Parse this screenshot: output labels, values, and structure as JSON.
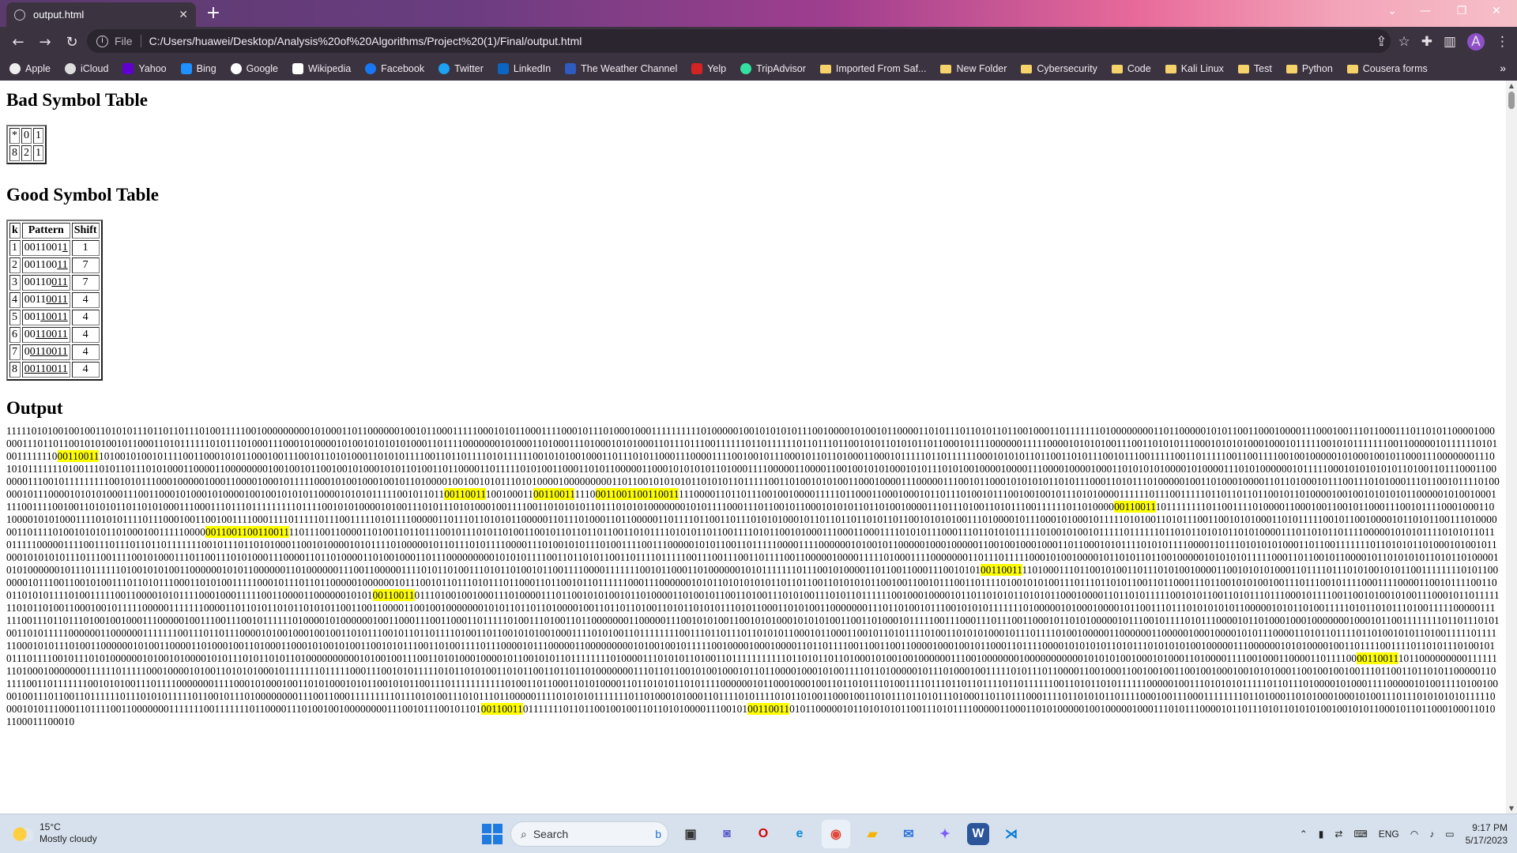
{
  "browser": {
    "tab_title": "output.html",
    "address_scheme": "File",
    "address_path": "C:/Users/huawei/Desktop/Analysis%20of%20Algorithms/Project%20(1)/Final/output.html",
    "profile_initial": "A",
    "bookmarks": [
      "Apple",
      "iCloud",
      "Yahoo",
      "Bing",
      "Google",
      "Wikipedia",
      "Facebook",
      "Twitter",
      "LinkedIn",
      "The Weather Channel",
      "Yelp",
      "TripAdvisor",
      "Imported From Saf...",
      "New Folder",
      "Cybersecurity",
      "Code",
      "Kali Linux",
      "Test",
      "Python",
      "Cousera forms"
    ]
  },
  "page": {
    "bad_title": "Bad Symbol Table",
    "bad_table": [
      [
        "*",
        "0",
        "1"
      ],
      [
        "8",
        "2",
        "1"
      ]
    ],
    "good_title": "Good Symbol Table",
    "good_headers": [
      "k",
      "Pattern",
      "Shift"
    ],
    "good_rows": [
      {
        "k": "1",
        "prefix": "0011001",
        "suffix": "1",
        "shift": "1"
      },
      {
        "k": "2",
        "prefix": "001100",
        "suffix": "11",
        "shift": "7"
      },
      {
        "k": "3",
        "prefix": "00110",
        "suffix": "011",
        "shift": "7"
      },
      {
        "k": "4",
        "prefix": "0011",
        "suffix": "0011",
        "shift": "4"
      },
      {
        "k": "5",
        "prefix": "001",
        "suffix": "10011",
        "shift": "4"
      },
      {
        "k": "6",
        "prefix": "00",
        "suffix": "110011",
        "shift": "4"
      },
      {
        "k": "7",
        "prefix": "0",
        "suffix": "0110011",
        "shift": "4"
      },
      {
        "k": "8",
        "prefix": "",
        "suffix": "00110011",
        "shift": "4"
      }
    ],
    "output_title": "Output",
    "output_lines": [
      [
        [
          "1111101010010010011010101110110110111010011111001000000000101000110110000001001011000111110001010110001111000101110100010001111111111010000010010101010111001000010100101100001101011101101011011001000110111111101000000001101100000101011001100",
          false
        ]
      ],
      [
        [
          "0100001110001001110110001110110101100001000000111011011001010100101100011010111111010111010001110001010000101001010101010001101111000000010100011010001110100010101000110111011100111111011011111101101110110010101101010110110",
          false
        ]
      ],
      [
        [
          "0010111100000011111000010101010011100110101011100010101010001000101111100101011111110011000001011111101010011111110",
          false
        ],
        [
          "00110011",
          true
        ],
        [
          "101001010010111100110001010110001001110010110101000110101011110011011011110101111110010101001000110111010110001110000111",
          false
        ]
      ],
      [
        [
          "1001001011100010110110100011000101111101101111110001010101101100110101110010111001111100110111110011001111001001000001010001001011000111000000011101010111111101001110101101110101000110000110000000010010010110010010100010101101001",
          false
        ]
      ],
      [
        [
          "1011000011011111010100110001101011000001100010101010110100011110000011000011001001010100010101110101001000010000111000010000100011010101010000101000011101010000001011111000101010101011010011011100011000000111001011111111100101011100010",
          false
        ]
      ],
      [
        [
          "0000100011000010001011111000101001000100101101000010010010101110101000010000000001101100101010101101010110111110011010010101001100010000111000001110010110001010101011010111000110101110100000100110100010000110110100010111001110101",
          false
        ]
      ],
      [
        [
          "00011101100101111010000010111000010101010001110011000101000101000010010010101011000010101011111001011011",
          false
        ],
        [
          "00110011",
          true
        ],
        [
          "100100011",
          false
        ],
        [
          "00110011",
          true
        ],
        [
          "1110",
          false
        ],
        [
          "0011001100110011",
          true
        ],
        [
          "1110000110110111001001000011111011000110001000101101110100101110010010010111010100001111110111001111",
          false
        ]
      ],
      [
        [
          "1011011011011001011010000100100101010101100000101001000111100111100100110101011011010100011100011101110111111111011110010101000010100111010111010100010011110011010101011011101010100000001010111100011101100101100010101011011010010",
          false
        ]
      ],
      [
        [
          "000111011101001101011100111111011010000",
          false
        ],
        [
          "00110011",
          true
        ],
        [
          "101111111101100111101000011000100110010110001110010111100010001101000010101000111101010111101110001001100100111100011110111110111001111101011110000011011101101010110000011011101000110110000011011110110011011101010100",
          false
        ]
      ],
      [
        [
          "0101101101101101011011001010101001110100001011100010100010111110101001101011100110010101000110101111100101100100001011010110011101000000110111101001010101101000100111110000",
          false
        ],
        [
          "0011001100110011",
          true
        ],
        [
          "110111001100001101001101101110010111010110100110010110110110110011010111101010110110011110101100101000111000110001111010101",
          false
        ]
      ],
      [
        [
          "1100011101101010111110100101001011111011111101101011010101101010000111011010110111100000101010111101010110110111110000011110011101110110110111111100101110110101000110010100001010111101000001011011101011110000111010010101110100111100111000",
          false
        ]
      ],
      [
        [
          "00101011001101111100001111000000101001011000001000100000110010010001000110110001010111101010111100001101110101010100011011001111111011010101101000101001011000101010101110111001111001010001110110011101010001110000110110100001101001000110111000000",
          false
        ]
      ],
      [
        [
          "00010101011110011011010110011011110111110011100111001101111001100000100001111101000111100000001101110111110001010010000101101011011001000001010101011111000110110010110000101101010101101011010000101010000001011101111110100101010011000000101011000000",
          false
        ]
      ],
      [
        [
          "1101000000111001100000111101011010011101011010010110011110000111111100101100011010000001010111111101110010100001101100110001110010101",
          false
        ],
        [
          "00110011",
          true
        ],
        [
          "110100011101100101001101110101001000011001010101000110111101110101001010110011111111010110000001011100110010100111011010111000110101001111100010",
          false
        ]
      ],
      [
        [
          "1110110110000010000001011100101101110101110110001101100101101111110001110000001010110101010101101101100110101010110010011001011100110111101001010100111011101101011001101100011101100101010010011101110010111100011110000110010111100110011010101",
          false
        ]
      ],
      [
        [
          "1110100111110011000010101111000100011111001100001100000010101",
          false
        ],
        [
          "00110011",
          true
        ],
        [
          "011101001001000111010000111011001010100101101000011010010110011010011101010011101011011111100100010000101101101010110101011000100001101101011111001010110011010111011100010111100110010100101001110001011011111110101101",
          false
        ]
      ],
      [
        [
          "0011000100101111100000111111100001101101011010110101011001100110000110010010000000101011011011010000100110110110100110101101010111010110001101010011000000011101101001011100101010111111101000001010001000010110011101110101010101100000101011010011111010110",
          false
        ]
      ],
      [
        [
          "1011101001111100000111111001110110111010010010001110000010011100111001011111101000010100000010011000111001100011011111010011101001101100000001100000111001010100110010101000101010100110011010001011111001110001110111001100010110101000001011100101111010111",
          false
        ]
      ],
      [
        [
          "0000101101000100010000000100010110011111111011011101010011010111110000001100000011111110011101101110000101001000100100110101110010110110111101001101100101010010001111010100110111111110011101101110110101011000101100011001011010111101001101010100010111011",
          false
        ]
      ],
      [
        [
          "1101001000001100000011000001000100001010111000011010110111101101001010110100111110111111000101011101001100000010100110000110100010011010001100010100101001100101011100110100111101110000101110000011000000000101001001011111001000010001000011011011110011",
          false
        ]
      ],
      [
        [
          "00110011",
          false
        ],
        [
          "0000100010010110001101111000010101010110101110101010100100000111000000101010000100110111100111101101011101001010111011110010111010100000010100101000010101110101101011010000000000101001001110011010100010000101100101011011111111010000111010101101",
          false
        ]
      ],
      [
        [
          "0011011111111111011010110110100010100100100000011100100000001000000000001010101001000101000110100001111001000110000110111100",
          false
        ],
        [
          "00110011",
          true
        ],
        [
          "1011000000000111111110100010000000111111011111000100001010011010101000101111111011111000111001010111110101101010011010110011011011010000000111011011001010010001",
          false
        ]
      ],
      [
        [
          "0110110000100010100111101101000001011101000100111110101110110000110010001100100100110010010001001010100011001001001001110110011011010110000011011110011011111110010101001110111100000001111000101000100110101000101011001010110011101111111111101001101",
          false
        ]
      ],
      [
        [
          "1000110101000011011010101101011110000001011000100010011011010111010011110111011011011110110111111001101011010111111000001001110101010111110110111010000101000111100000101001111010010000100111011001101111110111010101111101100101110100000000111001100",
          false
        ]
      ],
      [
        [
          "0111111111011101010011101011101100000111101010101111111011010001010001101111010111101011010011000100110101110110101110100011011011100011110110101011011110001001110001111111101101000110101000100010100111011101010101011111000010101110001101111001100000",
          false
        ]
      ],
      [
        [
          "00111111100111111101100001110100100100000000111001011100101101",
          false
        ],
        [
          "00110011",
          true
        ],
        [
          "0111111101101100100100110110101000011100101",
          false
        ],
        [
          "00110011",
          true
        ],
        [
          "010110000010110101010110011101011110000011000110101000001001000001000111010111000010110111010110101010010010101100010110110001000110101100011100010",
          false
        ]
      ]
    ]
  },
  "taskbar": {
    "temp": "15°C",
    "condition": "Mostly cloudy",
    "search_placeholder": "Search",
    "lang": "ENG",
    "time": "9:17 PM",
    "date": "5/17/2023"
  }
}
